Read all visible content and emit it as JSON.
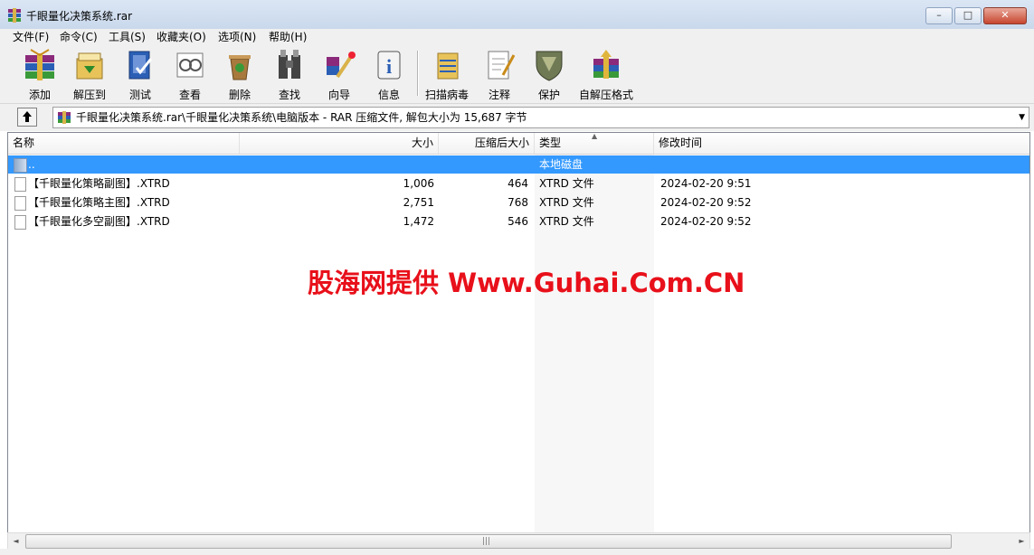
{
  "window": {
    "title": "千眼量化决策系统.rar",
    "controls": {
      "minimize": "▭",
      "maximize": "□",
      "close": "✕"
    }
  },
  "menu": [
    "文件(F)",
    "命令(C)",
    "工具(S)",
    "收藏夹(O)",
    "选项(N)",
    "帮助(H)"
  ],
  "toolbar": [
    {
      "label": "添加",
      "icon": "add-archive-icon"
    },
    {
      "label": "解压到",
      "icon": "extract-to-icon"
    },
    {
      "label": "测试",
      "icon": "test-icon"
    },
    {
      "label": "查看",
      "icon": "view-icon"
    },
    {
      "label": "删除",
      "icon": "delete-icon"
    },
    {
      "label": "查找",
      "icon": "find-icon"
    },
    {
      "label": "向导",
      "icon": "wizard-icon"
    },
    {
      "label": "信息",
      "icon": "info-icon"
    },
    {
      "label": "扫描病毒",
      "icon": "virus-scan-icon"
    },
    {
      "label": "注释",
      "icon": "comment-icon"
    },
    {
      "label": "保护",
      "icon": "protect-icon"
    },
    {
      "label": "自解压格式",
      "icon": "sfx-icon"
    }
  ],
  "address": {
    "text": "千眼量化决策系统.rar\\千眼量化决策系统\\电脑版本 - RAR 压缩文件, 解包大小为 15,687 字节"
  },
  "columns": {
    "name": "名称",
    "size": "大小",
    "packed": "压缩后大小",
    "type": "类型",
    "modified": "修改时间"
  },
  "rows": [
    {
      "name": "..",
      "size": "",
      "packed": "",
      "type": "本地磁盘",
      "modified": "",
      "selected": true,
      "kind": "folder"
    },
    {
      "name": "【千眼量化策略副图】.XTRD",
      "size": "1,006",
      "packed": "464",
      "type": "XTRD 文件",
      "modified": "2024-02-20 9:51",
      "kind": "file"
    },
    {
      "name": "【千眼量化策略主图】.XTRD",
      "size": "2,751",
      "packed": "768",
      "type": "XTRD 文件",
      "modified": "2024-02-20 9:52",
      "kind": "file"
    },
    {
      "name": "【千眼量化多空副图】.XTRD",
      "size": "1,472",
      "packed": "546",
      "type": "XTRD 文件",
      "modified": "2024-02-20 9:52",
      "kind": "file"
    }
  ],
  "watermark": "股海网提供 Www.Guhai.Com.CN",
  "scrollbar": {
    "left": "◄",
    "right": "►",
    "grip": "|||"
  },
  "colors": {
    "selection": "#3399ff",
    "watermark": "#e8101a"
  }
}
